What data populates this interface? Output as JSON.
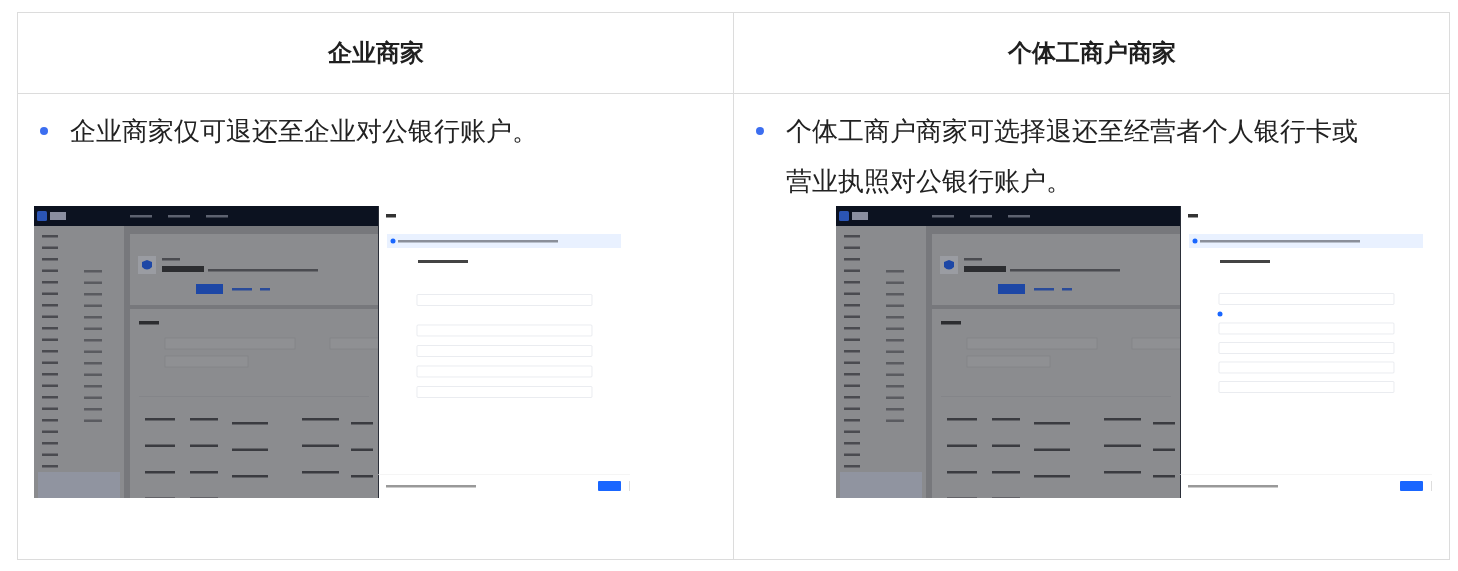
{
  "columns": [
    {
      "header": "企业商家",
      "bullet": "企业商家仅可退还至企业对公银行账户。"
    },
    {
      "header": "个体工商户商家",
      "bullet": "个体工商户商家可选择退还至经营者个人银行卡或营业执照对公银行账户。"
    }
  ]
}
